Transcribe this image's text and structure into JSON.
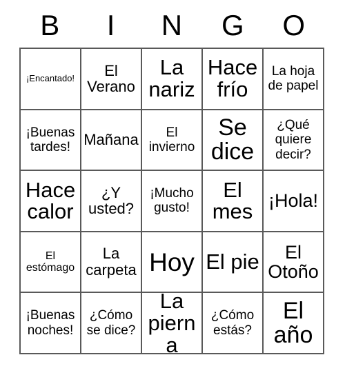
{
  "card": {
    "title_letters": [
      "B",
      "I",
      "N",
      "G",
      "O"
    ],
    "grid": {
      "columns": 5,
      "rows": 5,
      "border_color": "#595959",
      "background_color": "#ffffff",
      "text_color": "#000000"
    },
    "cells": [
      [
        {
          "text": "¡Encantado!",
          "size": "fs-xs"
        },
        {
          "text": "El Verano",
          "size": "fs-lg"
        },
        {
          "text": "La nariz",
          "size": "fs-2xl"
        },
        {
          "text": "Hace frío",
          "size": "fs-2xl"
        },
        {
          "text": "La hoja de papel",
          "size": "fs-md"
        }
      ],
      [
        {
          "text": "¡Buenas tardes!",
          "size": "fs-md"
        },
        {
          "text": "Mañana",
          "size": "fs-lg"
        },
        {
          "text": "El invierno",
          "size": "fs-md"
        },
        {
          "text": "Se dice",
          "size": "fs-3xl"
        },
        {
          "text": "¿Qué quiere decir?",
          "size": "fs-md"
        }
      ],
      [
        {
          "text": "Hace calor",
          "size": "fs-2xl"
        },
        {
          "text": "¿Y usted?",
          "size": "fs-lg"
        },
        {
          "text": "¡Mucho gusto!",
          "size": "fs-md"
        },
        {
          "text": "El mes",
          "size": "fs-2xl"
        },
        {
          "text": "¡Hola!",
          "size": "fs-xl"
        }
      ],
      [
        {
          "text": "El estómago",
          "size": "fs-sm"
        },
        {
          "text": "La carpeta",
          "size": "fs-lg"
        },
        {
          "text": "Hoy",
          "size": "fs-4xl"
        },
        {
          "text": "El pie",
          "size": "fs-2xl"
        },
        {
          "text": "El Otoño",
          "size": "fs-xl"
        }
      ],
      [
        {
          "text": "¡Buenas noches!",
          "size": "fs-md"
        },
        {
          "text": "¿Cómo se dice?",
          "size": "fs-md"
        },
        {
          "text": "La pierna",
          "size": "fs-2xl"
        },
        {
          "text": "¿Cómo estás?",
          "size": "fs-md"
        },
        {
          "text": "El año",
          "size": "fs-3xl"
        }
      ]
    ]
  }
}
